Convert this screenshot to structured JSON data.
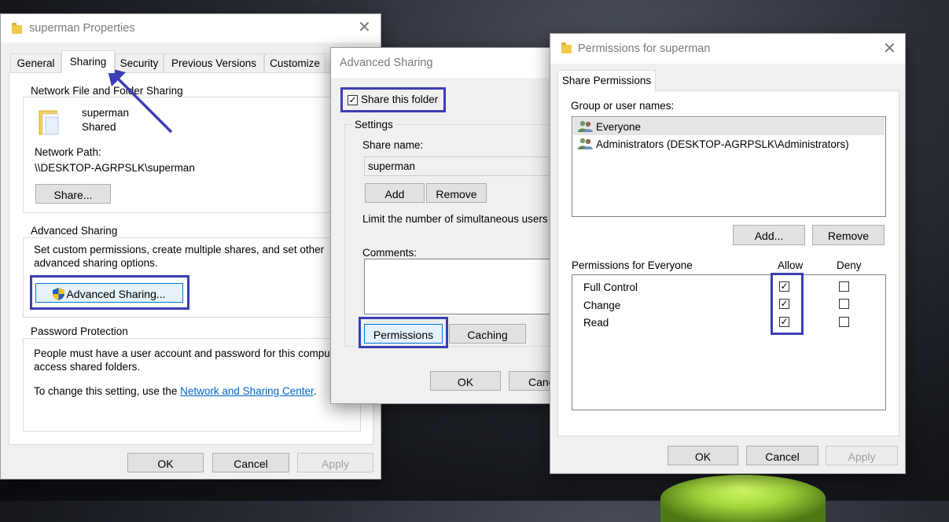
{
  "props": {
    "title": "superman Properties",
    "tabs": [
      "General",
      "Sharing",
      "Security",
      "Previous Versions",
      "Customize"
    ],
    "nffs_label": "Network File and Folder Sharing",
    "folder_name": "superman",
    "folder_state": "Shared",
    "network_path_label": "Network Path:",
    "network_path": "\\\\DESKTOP-AGRPSLK\\superman",
    "share_button": "Share...",
    "adv_label": "Advanced Sharing",
    "adv_desc1": "Set custom permissions, create multiple shares, and set other",
    "adv_desc2": "advanced sharing options.",
    "adv_button": "Advanced Sharing...",
    "pw_label": "Password Protection",
    "pw_desc1": "People must have a user account and password for this compute",
    "pw_desc2": "access shared folders.",
    "pw_change_prefix": "To change this setting, use the ",
    "pw_link": "Network and Sharing Center",
    "pw_change_suffix": ".",
    "ok": "OK",
    "cancel": "Cancel",
    "apply": "Apply"
  },
  "adv": {
    "title": "Advanced Sharing",
    "share_folder_label": "Share this folder",
    "settings_label": "Settings",
    "share_name_label": "Share name:",
    "share_name_value": "superman",
    "add": "Add",
    "remove": "Remove",
    "limit_label": "Limit the number of simultaneous users t",
    "comments_label": "Comments:",
    "permissions": "Permissions",
    "caching": "Caching",
    "ok": "OK",
    "cancel": "Canc"
  },
  "perm": {
    "title": "Permissions for superman",
    "tab": "Share Permissions",
    "group_label": "Group or user names:",
    "users": [
      "Everyone",
      "Administrators (DESKTOP-AGRPSLK\\Administrators)"
    ],
    "add": "Add...",
    "remove": "Remove",
    "perms_for": "Permissions for Everyone",
    "allow": "Allow",
    "deny": "Deny",
    "rows": [
      {
        "name": "Full Control",
        "allow": true,
        "deny": false
      },
      {
        "name": "Change",
        "allow": true,
        "deny": false
      },
      {
        "name": "Read",
        "allow": true,
        "deny": false
      }
    ],
    "ok": "OK",
    "cancel": "Cancel",
    "apply": "Apply"
  },
  "colors": {
    "highlight": "#3b3fb3",
    "link": "#0066cc",
    "selected_row": "#e5e5e5"
  }
}
